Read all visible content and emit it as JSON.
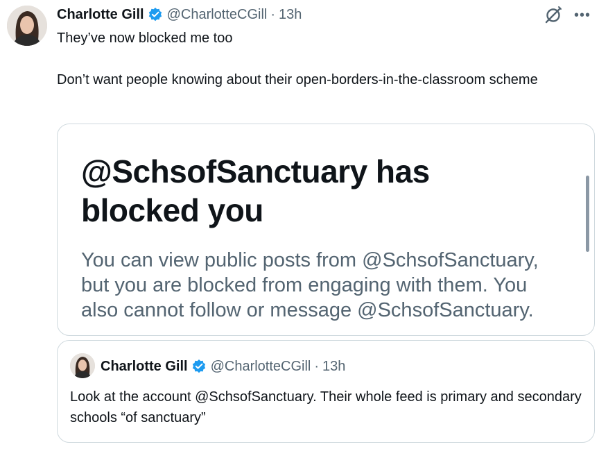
{
  "tweet": {
    "author_name": "Charlotte Gill",
    "author_handle": "@CharlotteCGill",
    "separator": "·",
    "time": "13h",
    "text_line1": "They’ve now blocked me too",
    "text_line2": "Don’t want people knowing about their open-borders-in-the-classroom scheme"
  },
  "media": {
    "title": "@SchsofSanctuary has blocked you",
    "body": "You can view public posts from @SchsofSanctuary, but you are blocked from engaging with them. You also cannot follow or message @SchsofSanctuary."
  },
  "quoted": {
    "author_name": "Charlotte Gill",
    "author_handle": "@CharlotteCGill",
    "separator": "·",
    "time": "13h",
    "text": "Look at the account @SchsofSanctuary. Their whole feed is primary and secondary schools “of sanctuary”"
  },
  "icons": {
    "verified": "verified-badge-icon",
    "grok": "grok-icon",
    "more": "more-options-icon"
  },
  "colors": {
    "verified_blue": "#1d9bf0",
    "secondary_text": "#536471",
    "border": "#cfd9de"
  }
}
